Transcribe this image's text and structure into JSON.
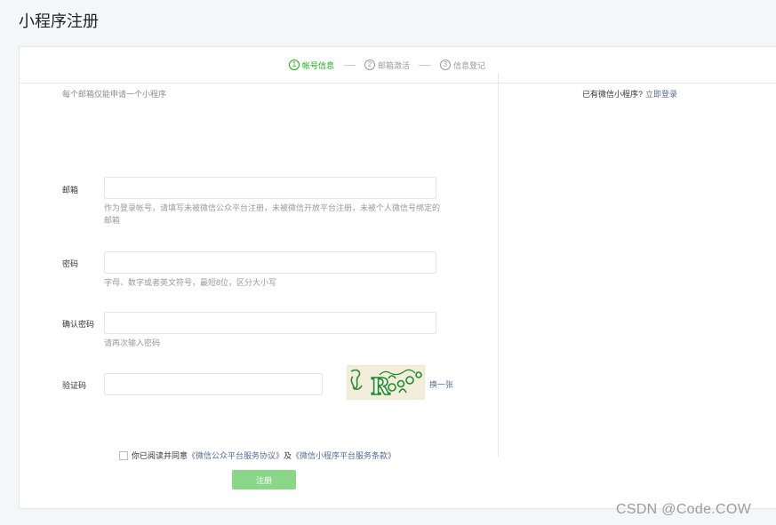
{
  "page": {
    "title": "小程序注册"
  },
  "steps": [
    {
      "num": "1",
      "label": "帐号信息",
      "active": true
    },
    {
      "num": "2",
      "label": "邮箱激活",
      "active": false
    },
    {
      "num": "3",
      "label": "信息登记",
      "active": false
    }
  ],
  "form": {
    "hint": "每个邮箱仅能申请一个小程序",
    "email": {
      "label": "邮箱",
      "value": "",
      "tip": "作为登录帐号，请填写未被微信公众平台注册，未被微信开放平台注册，未被个人微信号绑定的邮箱"
    },
    "password": {
      "label": "密码",
      "value": "",
      "tip": "字母、数字或者英文符号，最短8位，区分大小写"
    },
    "confirm": {
      "label": "确认密码",
      "value": "",
      "tip": "请再次输入密码"
    },
    "captcha": {
      "label": "验证码",
      "value": "",
      "refresh": "换一张",
      "image_text": "R"
    },
    "agreement": {
      "prefix": "你已阅读并同意",
      "link1": "《微信公众平台服务协议》",
      "and": "及",
      "link2": "《微信小程序平台服务条款》",
      "checked": false
    },
    "submit": "注册"
  },
  "side": {
    "text": "已有微信小程序?",
    "link": "立即登录"
  },
  "watermark": "CSDN @Code.COW",
  "colors": {
    "accent": "#1aad19",
    "link": "#576b95",
    "button_disabled": "#8ad78a"
  }
}
